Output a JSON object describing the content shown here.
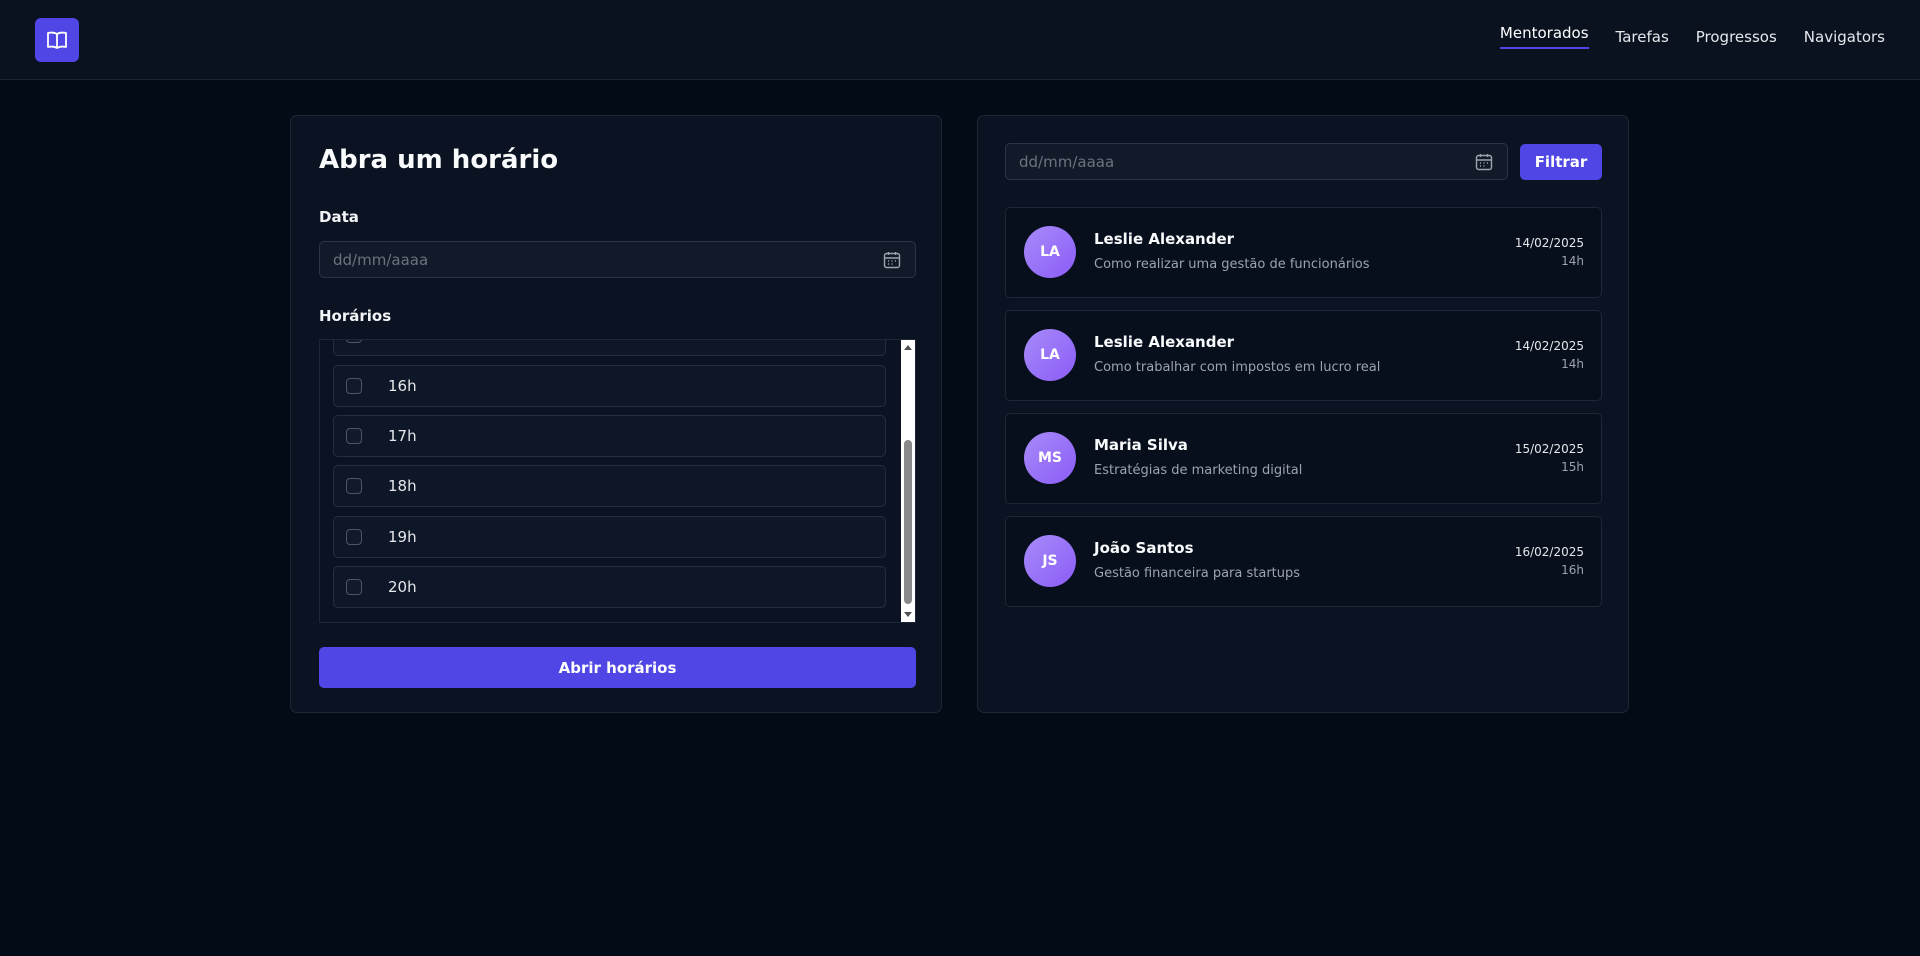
{
  "header": {
    "logo_icon": "open-book-icon",
    "nav": [
      {
        "label": "Mentorados",
        "active": true
      },
      {
        "label": "Tarefas",
        "active": false
      },
      {
        "label": "Progressos",
        "active": false
      },
      {
        "label": "Navigators",
        "active": false
      }
    ]
  },
  "left_panel": {
    "title": "Abra um horário",
    "date_label": "Data",
    "date_placeholder": "dd/mm/aaaa",
    "slots_label": "Horários",
    "slots": [
      "16h",
      "17h",
      "18h",
      "19h",
      "20h"
    ],
    "submit_label": "Abrir horários"
  },
  "right_panel": {
    "filter_placeholder": "dd/mm/aaaa",
    "filter_label": "Filtrar",
    "sessions": [
      {
        "initials": "LA",
        "name": "Leslie Alexander",
        "topic": "Como realizar uma gestão de funcionários",
        "date": "14/02/2025",
        "hour": "14h"
      },
      {
        "initials": "LA",
        "name": "Leslie Alexander",
        "topic": "Como trabalhar com impostos em lucro real",
        "date": "14/02/2025",
        "hour": "14h"
      },
      {
        "initials": "MS",
        "name": "Maria Silva",
        "topic": "Estratégias de marketing digital",
        "date": "15/02/2025",
        "hour": "15h"
      },
      {
        "initials": "JS",
        "name": "João Santos",
        "topic": "Gestão financeira para startups",
        "date": "16/02/2025",
        "hour": "16h"
      }
    ]
  },
  "colors": {
    "accent": "#4f46e5",
    "avatar": "#a78bfa",
    "background": "#030b17",
    "card": "#0b1322"
  }
}
